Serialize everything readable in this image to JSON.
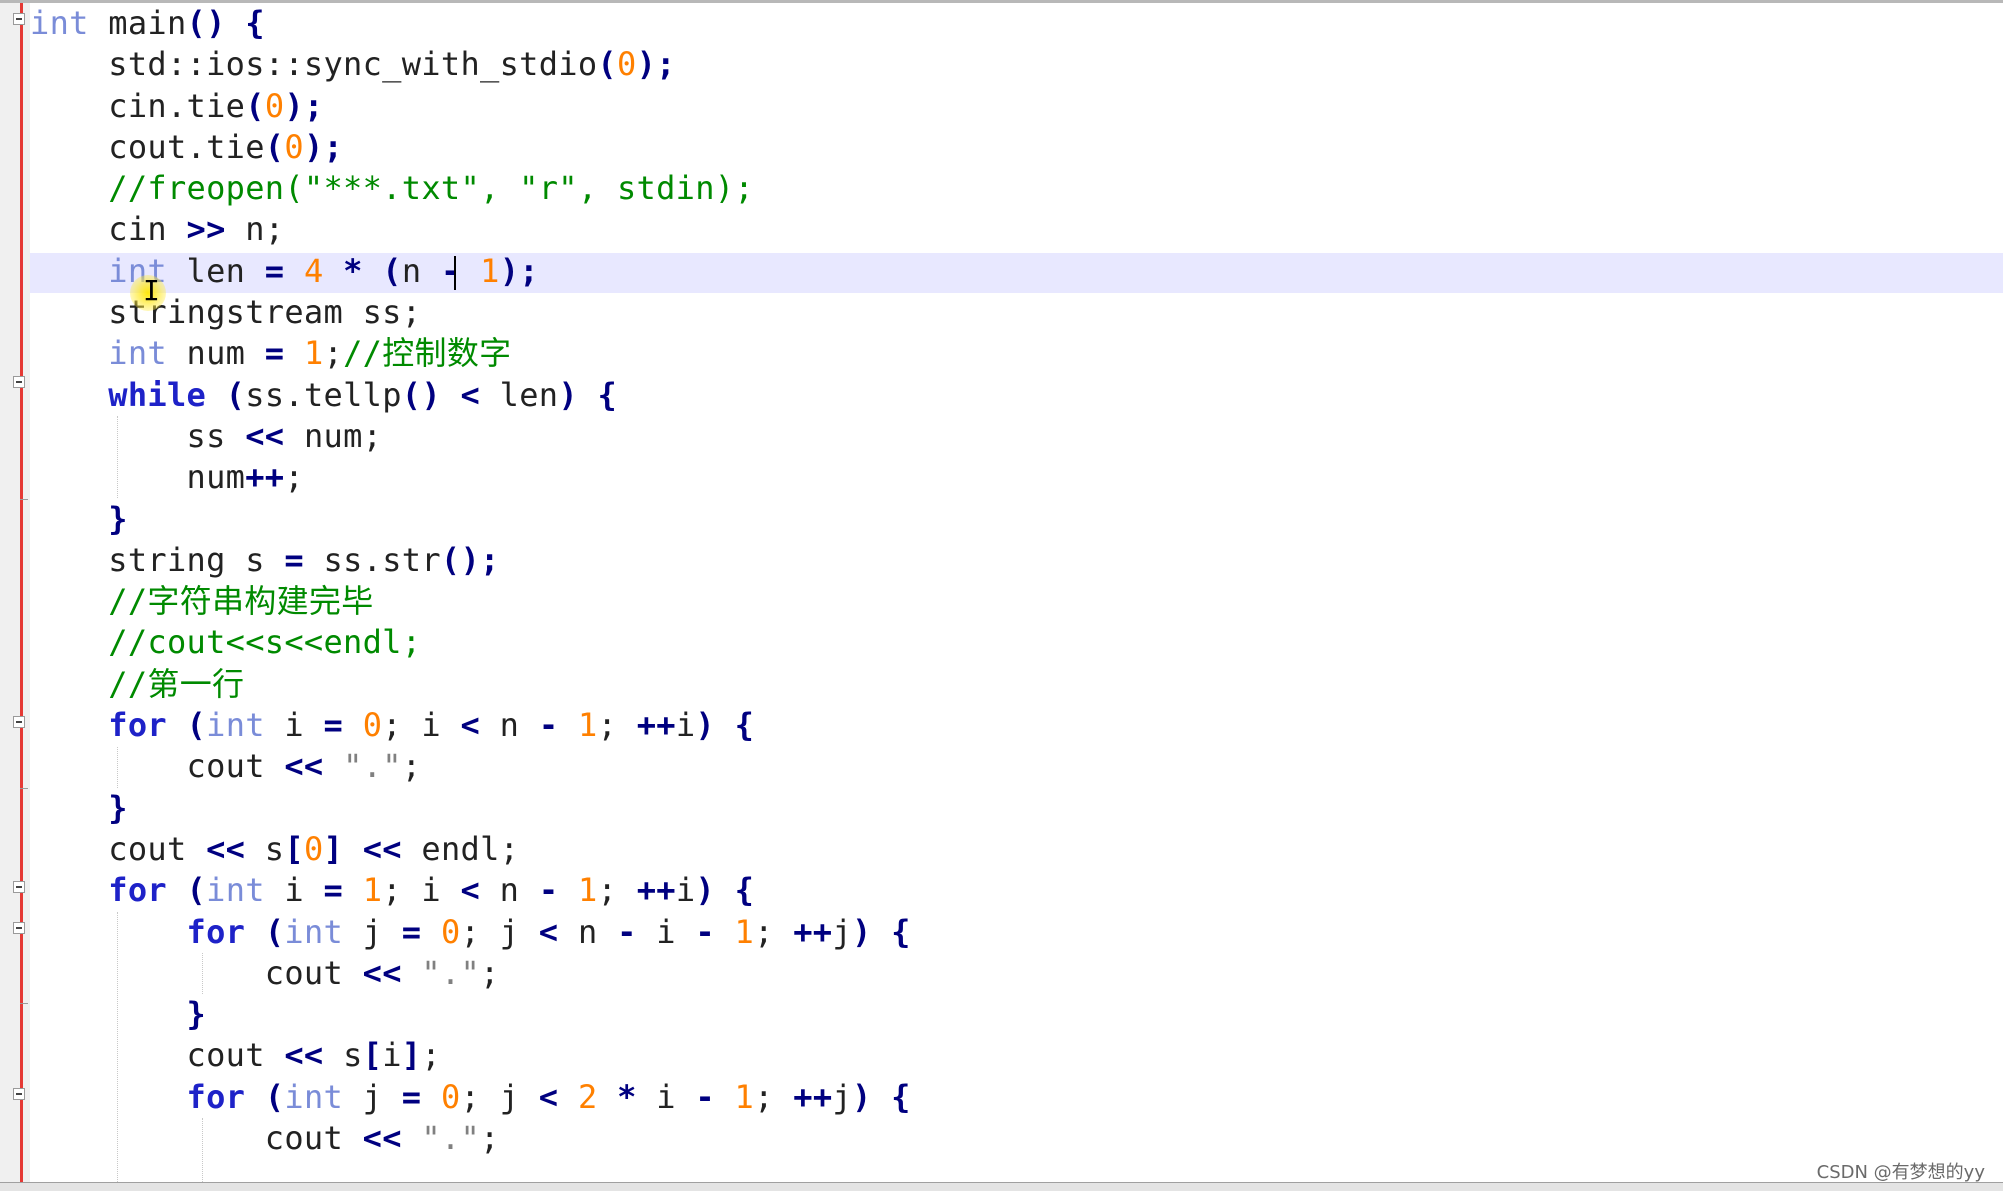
{
  "editor": {
    "language": "C++",
    "current_line": 7,
    "lines": [
      [
        {
          "t": "int",
          "c": "ty"
        },
        {
          "t": " main",
          "c": ""
        },
        {
          "t": "()",
          "c": "op"
        },
        {
          "t": " ",
          "c": ""
        },
        {
          "t": "{",
          "c": "op"
        }
      ],
      [
        {
          "t": "    std::ios::sync_with_stdio",
          "c": ""
        },
        {
          "t": "(",
          "c": "op"
        },
        {
          "t": "0",
          "c": "num"
        },
        {
          "t": ");",
          "c": "op"
        }
      ],
      [
        {
          "t": "    cin.tie",
          "c": ""
        },
        {
          "t": "(",
          "c": "op"
        },
        {
          "t": "0",
          "c": "num"
        },
        {
          "t": ");",
          "c": "op"
        }
      ],
      [
        {
          "t": "    cout.tie",
          "c": ""
        },
        {
          "t": "(",
          "c": "op"
        },
        {
          "t": "0",
          "c": "num"
        },
        {
          "t": ");",
          "c": "op"
        }
      ],
      [
        {
          "t": "    ",
          "c": ""
        },
        {
          "t": "//freopen(\"***.txt\", \"r\", stdin);",
          "c": "cm"
        }
      ],
      [
        {
          "t": "    cin ",
          "c": ""
        },
        {
          "t": ">>",
          "c": "op"
        },
        {
          "t": " n;",
          "c": ""
        }
      ],
      [
        {
          "t": "    ",
          "c": ""
        },
        {
          "t": "int",
          "c": "ty"
        },
        {
          "t": " len ",
          "c": ""
        },
        {
          "t": "=",
          "c": "op"
        },
        {
          "t": " ",
          "c": ""
        },
        {
          "t": "4",
          "c": "num"
        },
        {
          "t": " ",
          "c": ""
        },
        {
          "t": "*",
          "c": "op"
        },
        {
          "t": " ",
          "c": ""
        },
        {
          "t": "(",
          "c": "op"
        },
        {
          "t": "n ",
          "c": ""
        },
        {
          "t": "-",
          "c": "op"
        },
        {
          "t": " ",
          "c": ""
        },
        {
          "t": "1",
          "c": "num"
        },
        {
          "t": ");",
          "c": "op"
        }
      ],
      [
        {
          "t": "    stringstream ss;",
          "c": ""
        }
      ],
      [
        {
          "t": "    ",
          "c": ""
        },
        {
          "t": "int",
          "c": "ty"
        },
        {
          "t": " num ",
          "c": ""
        },
        {
          "t": "=",
          "c": "op"
        },
        {
          "t": " ",
          "c": ""
        },
        {
          "t": "1",
          "c": "num"
        },
        {
          "t": ";",
          "c": ""
        },
        {
          "t": "//控制数字",
          "c": "cm"
        }
      ],
      [
        {
          "t": "    ",
          "c": ""
        },
        {
          "t": "while",
          "c": "kw"
        },
        {
          "t": " ",
          "c": ""
        },
        {
          "t": "(",
          "c": "op"
        },
        {
          "t": "ss.tellp",
          "c": ""
        },
        {
          "t": "()",
          "c": "op"
        },
        {
          "t": " ",
          "c": ""
        },
        {
          "t": "<",
          "c": "op"
        },
        {
          "t": " len",
          "c": ""
        },
        {
          "t": ")",
          "c": "op"
        },
        {
          "t": " ",
          "c": ""
        },
        {
          "t": "{",
          "c": "op"
        }
      ],
      [
        {
          "t": "        ss ",
          "c": ""
        },
        {
          "t": "<<",
          "c": "op"
        },
        {
          "t": " num;",
          "c": ""
        }
      ],
      [
        {
          "t": "        num",
          "c": ""
        },
        {
          "t": "++",
          "c": "op"
        },
        {
          "t": ";",
          "c": ""
        }
      ],
      [
        {
          "t": "    ",
          "c": ""
        },
        {
          "t": "}",
          "c": "op"
        }
      ],
      [
        {
          "t": "    string s ",
          "c": ""
        },
        {
          "t": "=",
          "c": "op"
        },
        {
          "t": " ss.str",
          "c": ""
        },
        {
          "t": "();",
          "c": "op"
        }
      ],
      [
        {
          "t": "    ",
          "c": ""
        },
        {
          "t": "//字符串构建完毕",
          "c": "cm"
        }
      ],
      [
        {
          "t": "    ",
          "c": ""
        },
        {
          "t": "//cout<<s<<endl;",
          "c": "cm"
        }
      ],
      [
        {
          "t": "    ",
          "c": ""
        },
        {
          "t": "//第一行",
          "c": "cm"
        }
      ],
      [
        {
          "t": "    ",
          "c": ""
        },
        {
          "t": "for",
          "c": "kw"
        },
        {
          "t": " ",
          "c": ""
        },
        {
          "t": "(",
          "c": "op"
        },
        {
          "t": "int",
          "c": "ty"
        },
        {
          "t": " i ",
          "c": ""
        },
        {
          "t": "=",
          "c": "op"
        },
        {
          "t": " ",
          "c": ""
        },
        {
          "t": "0",
          "c": "num"
        },
        {
          "t": "; i ",
          "c": ""
        },
        {
          "t": "<",
          "c": "op"
        },
        {
          "t": " n ",
          "c": ""
        },
        {
          "t": "-",
          "c": "op"
        },
        {
          "t": " ",
          "c": ""
        },
        {
          "t": "1",
          "c": "num"
        },
        {
          "t": "; ",
          "c": ""
        },
        {
          "t": "++",
          "c": "op"
        },
        {
          "t": "i",
          "c": ""
        },
        {
          "t": ")",
          "c": "op"
        },
        {
          "t": " ",
          "c": ""
        },
        {
          "t": "{",
          "c": "op"
        }
      ],
      [
        {
          "t": "        cout ",
          "c": ""
        },
        {
          "t": "<<",
          "c": "op"
        },
        {
          "t": " ",
          "c": ""
        },
        {
          "t": "\".\"",
          "c": "str"
        },
        {
          "t": ";",
          "c": ""
        }
      ],
      [
        {
          "t": "    ",
          "c": ""
        },
        {
          "t": "}",
          "c": "op"
        }
      ],
      [
        {
          "t": "    cout ",
          "c": ""
        },
        {
          "t": "<<",
          "c": "op"
        },
        {
          "t": " s",
          "c": ""
        },
        {
          "t": "[",
          "c": "op"
        },
        {
          "t": "0",
          "c": "num"
        },
        {
          "t": "]",
          "c": "op"
        },
        {
          "t": " ",
          "c": ""
        },
        {
          "t": "<<",
          "c": "op"
        },
        {
          "t": " endl;",
          "c": ""
        }
      ],
      [
        {
          "t": "    ",
          "c": ""
        },
        {
          "t": "for",
          "c": "kw"
        },
        {
          "t": " ",
          "c": ""
        },
        {
          "t": "(",
          "c": "op"
        },
        {
          "t": "int",
          "c": "ty"
        },
        {
          "t": " i ",
          "c": ""
        },
        {
          "t": "=",
          "c": "op"
        },
        {
          "t": " ",
          "c": ""
        },
        {
          "t": "1",
          "c": "num"
        },
        {
          "t": "; i ",
          "c": ""
        },
        {
          "t": "<",
          "c": "op"
        },
        {
          "t": " n ",
          "c": ""
        },
        {
          "t": "-",
          "c": "op"
        },
        {
          "t": " ",
          "c": ""
        },
        {
          "t": "1",
          "c": "num"
        },
        {
          "t": "; ",
          "c": ""
        },
        {
          "t": "++",
          "c": "op"
        },
        {
          "t": "i",
          "c": ""
        },
        {
          "t": ")",
          "c": "op"
        },
        {
          "t": " ",
          "c": ""
        },
        {
          "t": "{",
          "c": "op"
        }
      ],
      [
        {
          "t": "        ",
          "c": ""
        },
        {
          "t": "for",
          "c": "kw"
        },
        {
          "t": " ",
          "c": ""
        },
        {
          "t": "(",
          "c": "op"
        },
        {
          "t": "int",
          "c": "ty"
        },
        {
          "t": " j ",
          "c": ""
        },
        {
          "t": "=",
          "c": "op"
        },
        {
          "t": " ",
          "c": ""
        },
        {
          "t": "0",
          "c": "num"
        },
        {
          "t": "; j ",
          "c": ""
        },
        {
          "t": "<",
          "c": "op"
        },
        {
          "t": " n ",
          "c": ""
        },
        {
          "t": "-",
          "c": "op"
        },
        {
          "t": " i ",
          "c": ""
        },
        {
          "t": "-",
          "c": "op"
        },
        {
          "t": " ",
          "c": ""
        },
        {
          "t": "1",
          "c": "num"
        },
        {
          "t": "; ",
          "c": ""
        },
        {
          "t": "++",
          "c": "op"
        },
        {
          "t": "j",
          "c": ""
        },
        {
          "t": ")",
          "c": "op"
        },
        {
          "t": " ",
          "c": ""
        },
        {
          "t": "{",
          "c": "op"
        }
      ],
      [
        {
          "t": "            cout ",
          "c": ""
        },
        {
          "t": "<<",
          "c": "op"
        },
        {
          "t": " ",
          "c": ""
        },
        {
          "t": "\".\"",
          "c": "str"
        },
        {
          "t": ";",
          "c": ""
        }
      ],
      [
        {
          "t": "        ",
          "c": ""
        },
        {
          "t": "}",
          "c": "op"
        }
      ],
      [
        {
          "t": "        cout ",
          "c": ""
        },
        {
          "t": "<<",
          "c": "op"
        },
        {
          "t": " s",
          "c": ""
        },
        {
          "t": "[",
          "c": "op"
        },
        {
          "t": "i",
          "c": ""
        },
        {
          "t": "]",
          "c": "op"
        },
        {
          "t": ";",
          "c": ""
        }
      ],
      [
        {
          "t": "        ",
          "c": ""
        },
        {
          "t": "for",
          "c": "kw"
        },
        {
          "t": " ",
          "c": ""
        },
        {
          "t": "(",
          "c": "op"
        },
        {
          "t": "int",
          "c": "ty"
        },
        {
          "t": " j ",
          "c": ""
        },
        {
          "t": "=",
          "c": "op"
        },
        {
          "t": " ",
          "c": ""
        },
        {
          "t": "0",
          "c": "num"
        },
        {
          "t": "; j ",
          "c": ""
        },
        {
          "t": "<",
          "c": "op"
        },
        {
          "t": " ",
          "c": ""
        },
        {
          "t": "2",
          "c": "num"
        },
        {
          "t": " ",
          "c": ""
        },
        {
          "t": "*",
          "c": "op"
        },
        {
          "t": " i ",
          "c": ""
        },
        {
          "t": "-",
          "c": "op"
        },
        {
          "t": " ",
          "c": ""
        },
        {
          "t": "1",
          "c": "num"
        },
        {
          "t": "; ",
          "c": ""
        },
        {
          "t": "++",
          "c": "op"
        },
        {
          "t": "j",
          "c": ""
        },
        {
          "t": ")",
          "c": "op"
        },
        {
          "t": " ",
          "c": ""
        },
        {
          "t": "{",
          "c": "op"
        }
      ],
      [
        {
          "t": "            cout ",
          "c": ""
        },
        {
          "t": "<<",
          "c": "op"
        },
        {
          "t": " ",
          "c": ""
        },
        {
          "t": "\".\"",
          "c": "str"
        },
        {
          "t": ";",
          "c": ""
        }
      ]
    ]
  },
  "watermark": "CSDN @有梦想的yy",
  "colors": {
    "keyword": "#1e22c8",
    "type": "#7a8cd8",
    "number": "#ff8000",
    "comment": "#008a00",
    "operator": "#000080",
    "string": "#808080",
    "current_line_bg": "#e8e8ff",
    "change_bar": "#e53935"
  },
  "icons": [
    "fold-minus-icon",
    "mouse-ibeam-icon"
  ]
}
